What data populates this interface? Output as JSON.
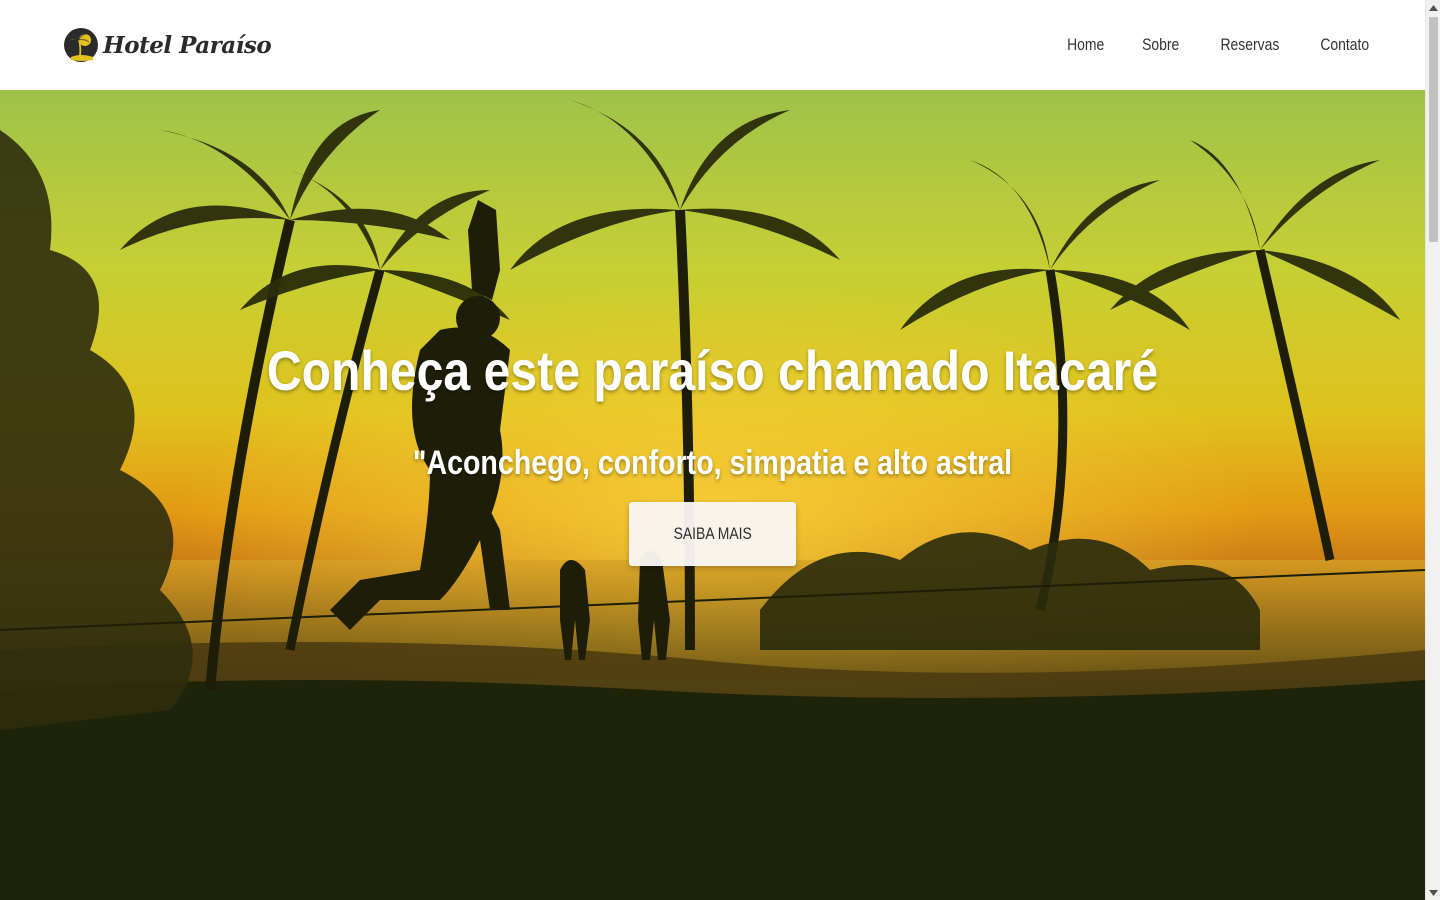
{
  "brand": {
    "name": "Hotel Paraíso",
    "logo_icon": "palm-tree-circle-icon"
  },
  "nav": {
    "items": [
      {
        "label": "Home"
      },
      {
        "label": "Sobre"
      },
      {
        "label": "Reservas"
      },
      {
        "label": "Contato"
      }
    ]
  },
  "hero": {
    "title": "Conheça este paraíso chamado Itacaré",
    "subtitle": "\"Aconchego, conforto, simpatia e alto astral",
    "button_label": "SAIBA MAIS",
    "background_image": "sunset-beach-palm-trees-slackline"
  },
  "colors": {
    "header_bg": "#ffffff",
    "hero_text": "#ffffff",
    "button_bg": "#f8f6f4",
    "logo_accent": "#e3c21b"
  }
}
